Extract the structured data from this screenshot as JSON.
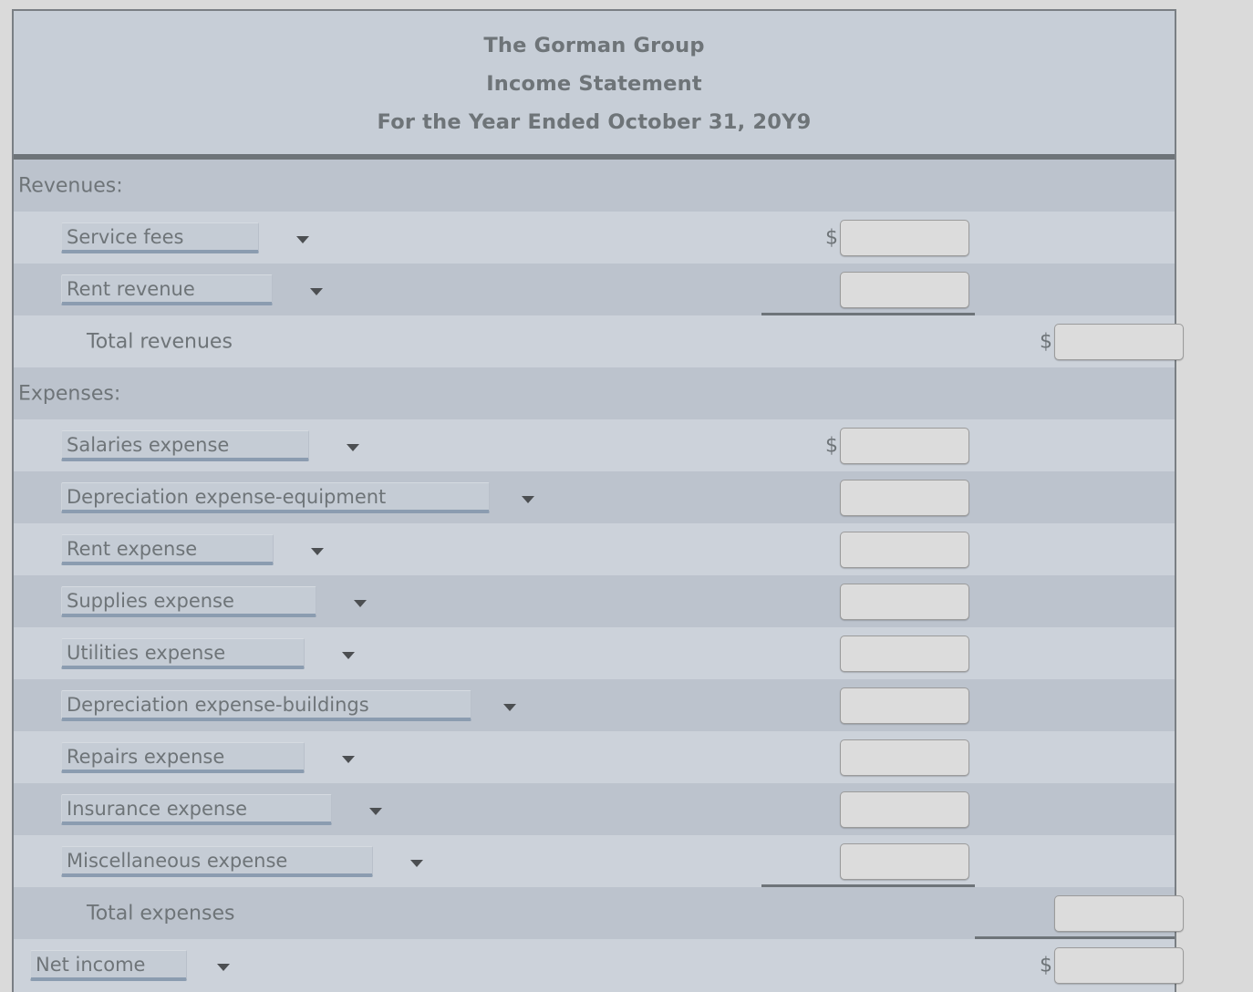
{
  "header": {
    "company": "The Gorman Group",
    "statement": "Income Statement",
    "period": "For the Year Ended October 31, 20Y9"
  },
  "colors": {
    "page_background": "#dadada",
    "row_dark": "#bcc3cd",
    "row_light": "#ccd2da",
    "text": "#6e7478",
    "select_underline": "#8b9cb0",
    "input_fill": "#dcdcdc",
    "rule": "#6e7479"
  },
  "sections": {
    "revenues_label": "Revenues:",
    "expenses_label": "Expenses:",
    "total_revenues_label": "Total revenues",
    "total_expenses_label": "Total expenses"
  },
  "symbols": {
    "dollar": "$",
    "dropdown_arrow": "chevron-down-icon"
  },
  "revenues": [
    {
      "account": "Service fees",
      "amount": "",
      "placeholder": ""
    },
    {
      "account": "Rent revenue",
      "amount": "",
      "placeholder": ""
    }
  ],
  "total_revenues": {
    "amount": "",
    "placeholder": ""
  },
  "expenses": [
    {
      "account": "Salaries expense",
      "amount": "",
      "placeholder": ""
    },
    {
      "account": "Depreciation expense-equipment",
      "amount": "",
      "placeholder": ""
    },
    {
      "account": "Rent expense",
      "amount": "",
      "placeholder": ""
    },
    {
      "account": "Supplies expense",
      "amount": "",
      "placeholder": ""
    },
    {
      "account": "Utilities expense",
      "amount": "",
      "placeholder": ""
    },
    {
      "account": "Depreciation expense-buildings",
      "amount": "",
      "placeholder": ""
    },
    {
      "account": "Repairs expense",
      "amount": "",
      "placeholder": ""
    },
    {
      "account": "Insurance expense",
      "amount": "",
      "placeholder": ""
    },
    {
      "account": "Miscellaneous expense",
      "amount": "",
      "placeholder": ""
    }
  ],
  "total_expenses": {
    "amount": "",
    "placeholder": ""
  },
  "net_income": {
    "account": "Net income",
    "amount": "",
    "placeholder": ""
  },
  "account_options": [
    "Service fees",
    "Rent revenue",
    "Salaries expense",
    "Depreciation expense-equipment",
    "Rent expense",
    "Supplies expense",
    "Utilities expense",
    "Depreciation expense-buildings",
    "Repairs expense",
    "Insurance expense",
    "Miscellaneous expense",
    "Net income"
  ]
}
